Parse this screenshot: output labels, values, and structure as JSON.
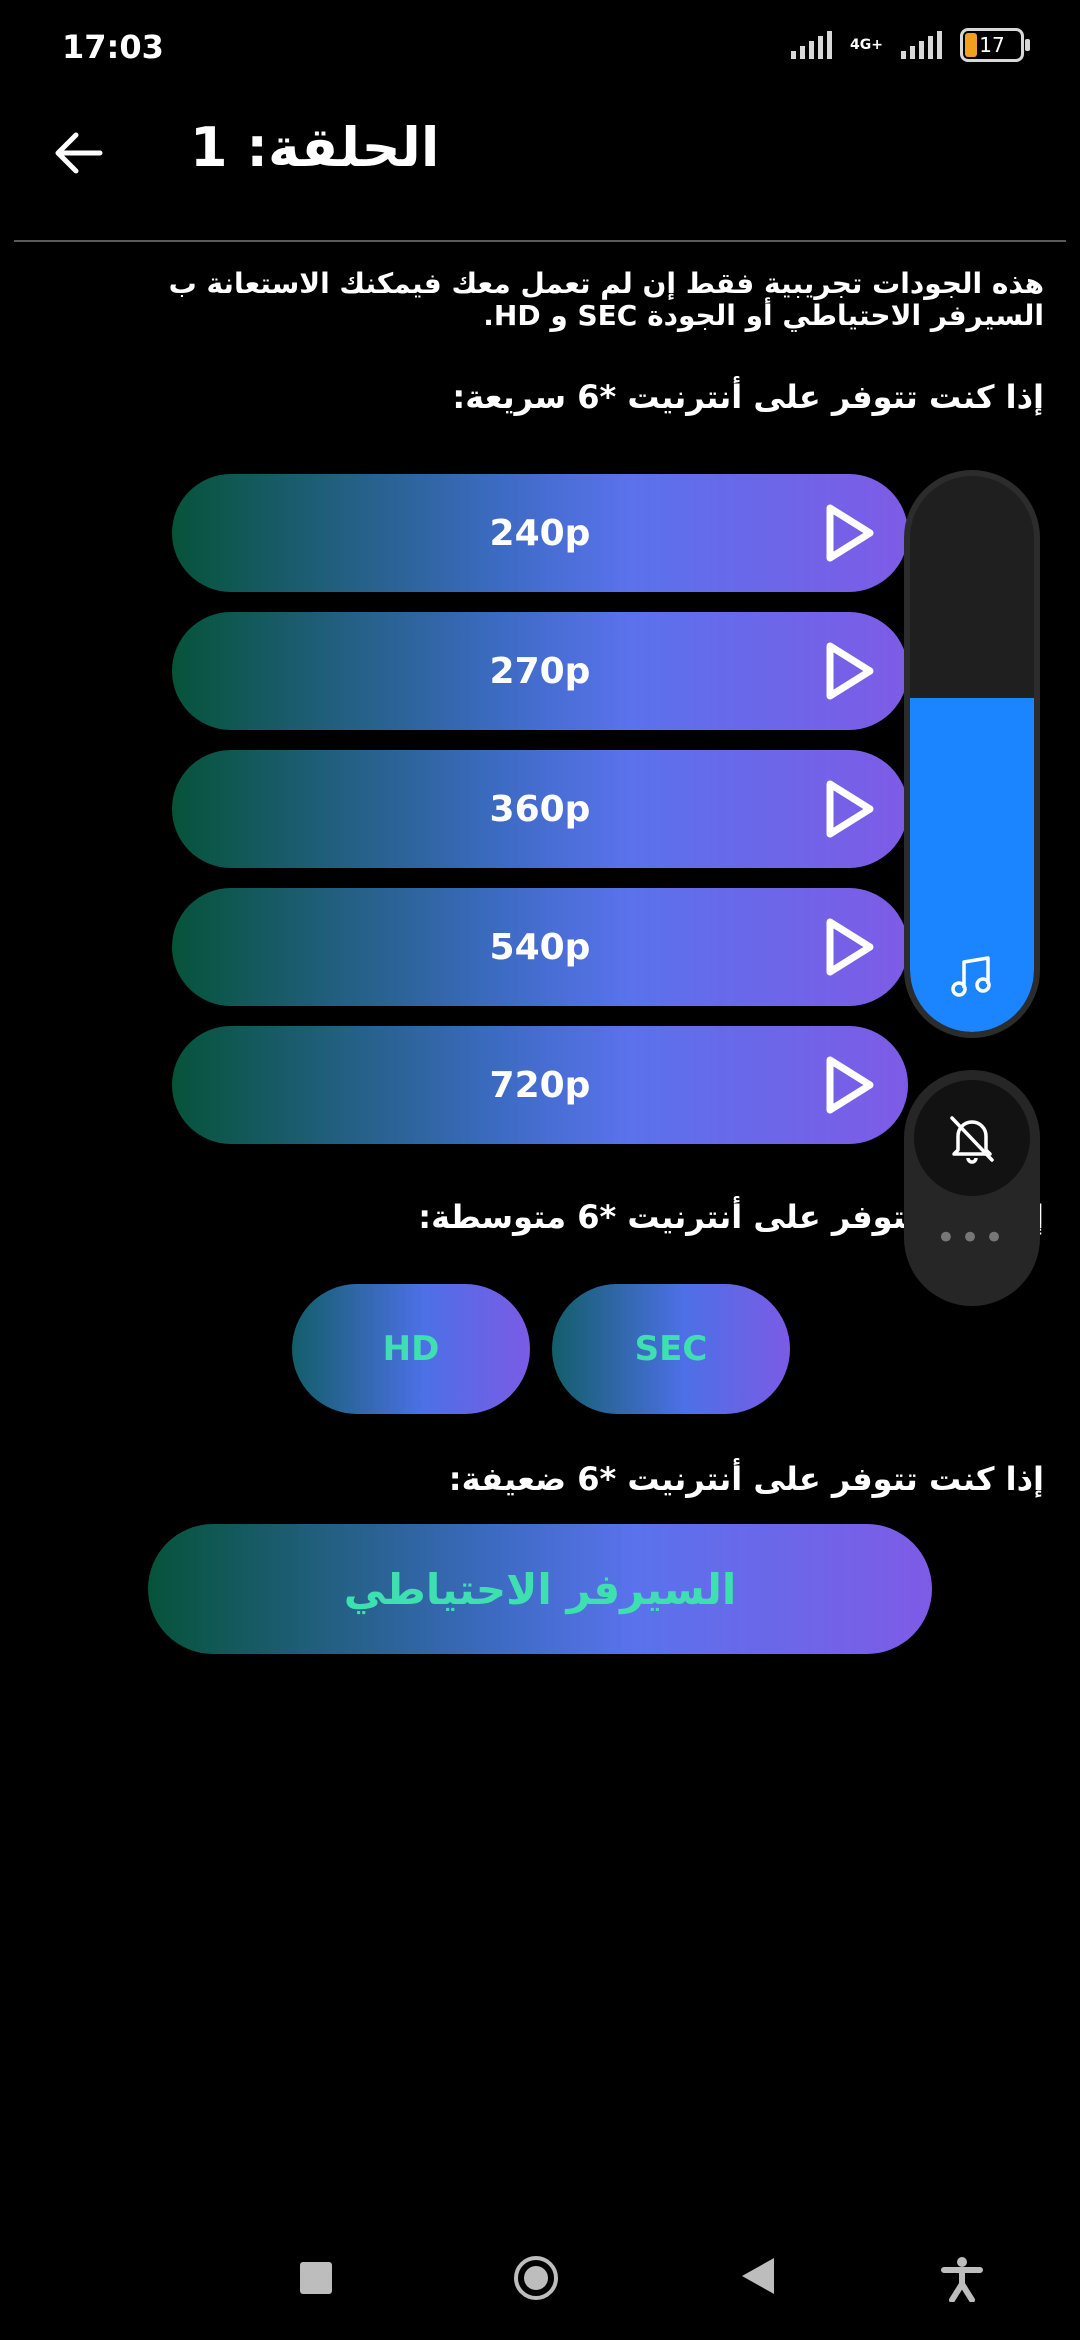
{
  "status_bar": {
    "time": "17:03",
    "battery": "17",
    "network": "4G+"
  },
  "header": {
    "title": "الحلقة: 1"
  },
  "notice": "هذه الجودات تجريبية فقط إن لم تعمل معك فيمكنك الاستعانة ب السيرفر الاحتياطي أو الجودة SEC و HD.",
  "sections": {
    "fast": "إذا كنت تتوفر على أنترنيت *6 سريعة:",
    "medium": "إذا كنت تتوفر على أنترنيت *6 متوسطة:",
    "slow": "إذا كنت تتوفر على أنترنيت *6 ضعيفة:"
  },
  "qualities": [
    "240p",
    "270p",
    "360p",
    "540p",
    "720p"
  ],
  "medium_buttons": {
    "hd": "HD",
    "sec": "SEC"
  },
  "backup_server": "السيرفر الاحتياطي",
  "volume_overlay": {
    "level_percent": 60,
    "more": "•••"
  },
  "colors": {
    "accent_green": "#3fe0b0",
    "volume_blue": "#1a85ff",
    "gradient_start": "#06533a",
    "gradient_end": "#7e5be6"
  }
}
